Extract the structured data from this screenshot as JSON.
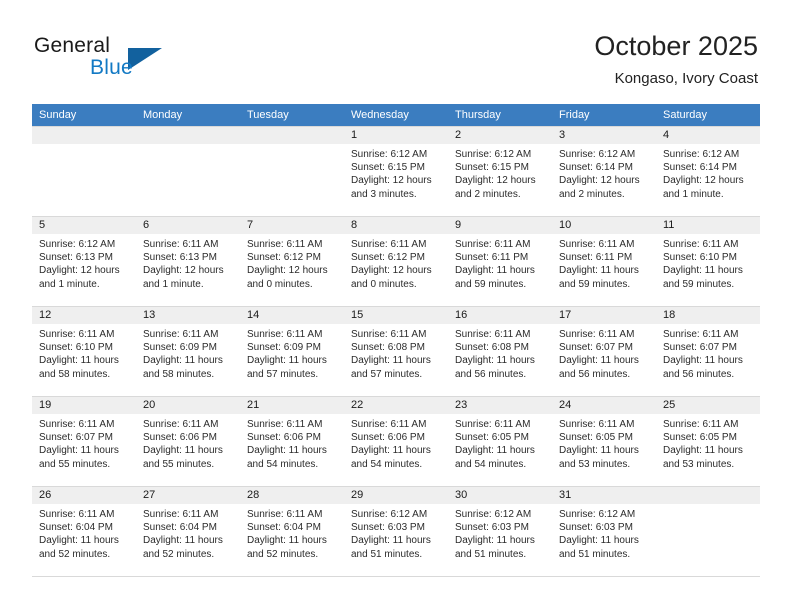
{
  "brand": {
    "line1": "General",
    "line2": "Blue",
    "triangle_icon": "triangle-icon",
    "accent_color": "#12619e",
    "blue_color": "#1279c4"
  },
  "header": {
    "title": "October 2025",
    "subtitle": "Kongaso, Ivory Coast"
  },
  "calendar": {
    "header_bg": "#3b7dc0",
    "daynum_bg": "#efefef",
    "weekday_headers": [
      "Sunday",
      "Monday",
      "Tuesday",
      "Wednesday",
      "Thursday",
      "Friday",
      "Saturday"
    ],
    "weeks": [
      [
        {
          "day": "",
          "sunrise": "",
          "sunset": "",
          "daylight1": "",
          "daylight2": "",
          "empty": true
        },
        {
          "day": "",
          "sunrise": "",
          "sunset": "",
          "daylight1": "",
          "daylight2": "",
          "empty": true
        },
        {
          "day": "",
          "sunrise": "",
          "sunset": "",
          "daylight1": "",
          "daylight2": "",
          "empty": true
        },
        {
          "day": "1",
          "sunrise": "Sunrise: 6:12 AM",
          "sunset": "Sunset: 6:15 PM",
          "daylight1": "Daylight: 12 hours",
          "daylight2": "and 3 minutes."
        },
        {
          "day": "2",
          "sunrise": "Sunrise: 6:12 AM",
          "sunset": "Sunset: 6:15 PM",
          "daylight1": "Daylight: 12 hours",
          "daylight2": "and 2 minutes."
        },
        {
          "day": "3",
          "sunrise": "Sunrise: 6:12 AM",
          "sunset": "Sunset: 6:14 PM",
          "daylight1": "Daylight: 12 hours",
          "daylight2": "and 2 minutes."
        },
        {
          "day": "4",
          "sunrise": "Sunrise: 6:12 AM",
          "sunset": "Sunset: 6:14 PM",
          "daylight1": "Daylight: 12 hours",
          "daylight2": "and 1 minute."
        }
      ],
      [
        {
          "day": "5",
          "sunrise": "Sunrise: 6:12 AM",
          "sunset": "Sunset: 6:13 PM",
          "daylight1": "Daylight: 12 hours",
          "daylight2": "and 1 minute."
        },
        {
          "day": "6",
          "sunrise": "Sunrise: 6:11 AM",
          "sunset": "Sunset: 6:13 PM",
          "daylight1": "Daylight: 12 hours",
          "daylight2": "and 1 minute."
        },
        {
          "day": "7",
          "sunrise": "Sunrise: 6:11 AM",
          "sunset": "Sunset: 6:12 PM",
          "daylight1": "Daylight: 12 hours",
          "daylight2": "and 0 minutes."
        },
        {
          "day": "8",
          "sunrise": "Sunrise: 6:11 AM",
          "sunset": "Sunset: 6:12 PM",
          "daylight1": "Daylight: 12 hours",
          "daylight2": "and 0 minutes."
        },
        {
          "day": "9",
          "sunrise": "Sunrise: 6:11 AM",
          "sunset": "Sunset: 6:11 PM",
          "daylight1": "Daylight: 11 hours",
          "daylight2": "and 59 minutes."
        },
        {
          "day": "10",
          "sunrise": "Sunrise: 6:11 AM",
          "sunset": "Sunset: 6:11 PM",
          "daylight1": "Daylight: 11 hours",
          "daylight2": "and 59 minutes."
        },
        {
          "day": "11",
          "sunrise": "Sunrise: 6:11 AM",
          "sunset": "Sunset: 6:10 PM",
          "daylight1": "Daylight: 11 hours",
          "daylight2": "and 59 minutes."
        }
      ],
      [
        {
          "day": "12",
          "sunrise": "Sunrise: 6:11 AM",
          "sunset": "Sunset: 6:10 PM",
          "daylight1": "Daylight: 11 hours",
          "daylight2": "and 58 minutes."
        },
        {
          "day": "13",
          "sunrise": "Sunrise: 6:11 AM",
          "sunset": "Sunset: 6:09 PM",
          "daylight1": "Daylight: 11 hours",
          "daylight2": "and 58 minutes."
        },
        {
          "day": "14",
          "sunrise": "Sunrise: 6:11 AM",
          "sunset": "Sunset: 6:09 PM",
          "daylight1": "Daylight: 11 hours",
          "daylight2": "and 57 minutes."
        },
        {
          "day": "15",
          "sunrise": "Sunrise: 6:11 AM",
          "sunset": "Sunset: 6:08 PM",
          "daylight1": "Daylight: 11 hours",
          "daylight2": "and 57 minutes."
        },
        {
          "day": "16",
          "sunrise": "Sunrise: 6:11 AM",
          "sunset": "Sunset: 6:08 PM",
          "daylight1": "Daylight: 11 hours",
          "daylight2": "and 56 minutes."
        },
        {
          "day": "17",
          "sunrise": "Sunrise: 6:11 AM",
          "sunset": "Sunset: 6:07 PM",
          "daylight1": "Daylight: 11 hours",
          "daylight2": "and 56 minutes."
        },
        {
          "day": "18",
          "sunrise": "Sunrise: 6:11 AM",
          "sunset": "Sunset: 6:07 PM",
          "daylight1": "Daylight: 11 hours",
          "daylight2": "and 56 minutes."
        }
      ],
      [
        {
          "day": "19",
          "sunrise": "Sunrise: 6:11 AM",
          "sunset": "Sunset: 6:07 PM",
          "daylight1": "Daylight: 11 hours",
          "daylight2": "and 55 minutes."
        },
        {
          "day": "20",
          "sunrise": "Sunrise: 6:11 AM",
          "sunset": "Sunset: 6:06 PM",
          "daylight1": "Daylight: 11 hours",
          "daylight2": "and 55 minutes."
        },
        {
          "day": "21",
          "sunrise": "Sunrise: 6:11 AM",
          "sunset": "Sunset: 6:06 PM",
          "daylight1": "Daylight: 11 hours",
          "daylight2": "and 54 minutes."
        },
        {
          "day": "22",
          "sunrise": "Sunrise: 6:11 AM",
          "sunset": "Sunset: 6:06 PM",
          "daylight1": "Daylight: 11 hours",
          "daylight2": "and 54 minutes."
        },
        {
          "day": "23",
          "sunrise": "Sunrise: 6:11 AM",
          "sunset": "Sunset: 6:05 PM",
          "daylight1": "Daylight: 11 hours",
          "daylight2": "and 54 minutes."
        },
        {
          "day": "24",
          "sunrise": "Sunrise: 6:11 AM",
          "sunset": "Sunset: 6:05 PM",
          "daylight1": "Daylight: 11 hours",
          "daylight2": "and 53 minutes."
        },
        {
          "day": "25",
          "sunrise": "Sunrise: 6:11 AM",
          "sunset": "Sunset: 6:05 PM",
          "daylight1": "Daylight: 11 hours",
          "daylight2": "and 53 minutes."
        }
      ],
      [
        {
          "day": "26",
          "sunrise": "Sunrise: 6:11 AM",
          "sunset": "Sunset: 6:04 PM",
          "daylight1": "Daylight: 11 hours",
          "daylight2": "and 52 minutes."
        },
        {
          "day": "27",
          "sunrise": "Sunrise: 6:11 AM",
          "sunset": "Sunset: 6:04 PM",
          "daylight1": "Daylight: 11 hours",
          "daylight2": "and 52 minutes."
        },
        {
          "day": "28",
          "sunrise": "Sunrise: 6:11 AM",
          "sunset": "Sunset: 6:04 PM",
          "daylight1": "Daylight: 11 hours",
          "daylight2": "and 52 minutes."
        },
        {
          "day": "29",
          "sunrise": "Sunrise: 6:12 AM",
          "sunset": "Sunset: 6:03 PM",
          "daylight1": "Daylight: 11 hours",
          "daylight2": "and 51 minutes."
        },
        {
          "day": "30",
          "sunrise": "Sunrise: 6:12 AM",
          "sunset": "Sunset: 6:03 PM",
          "daylight1": "Daylight: 11 hours",
          "daylight2": "and 51 minutes."
        },
        {
          "day": "31",
          "sunrise": "Sunrise: 6:12 AM",
          "sunset": "Sunset: 6:03 PM",
          "daylight1": "Daylight: 11 hours",
          "daylight2": "and 51 minutes."
        },
        {
          "day": "",
          "sunrise": "",
          "sunset": "",
          "daylight1": "",
          "daylight2": "",
          "empty": true
        }
      ]
    ]
  }
}
